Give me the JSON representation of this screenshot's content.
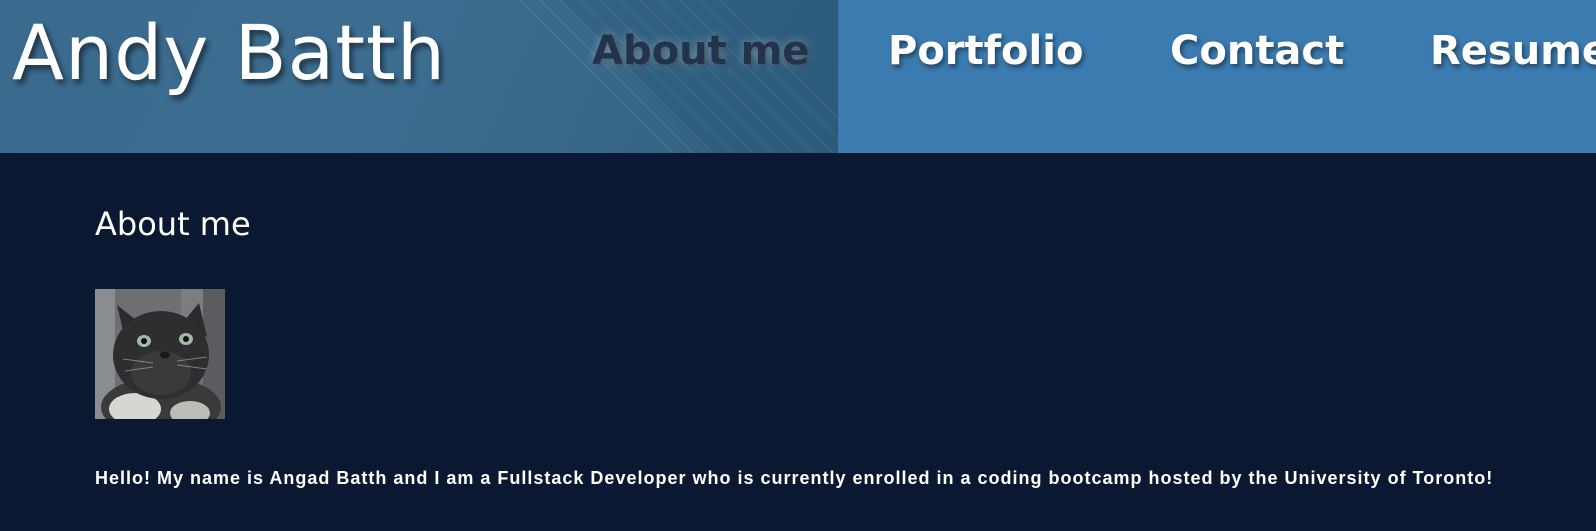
{
  "header": {
    "site_title": "Andy Batth",
    "nav": {
      "about": "About me",
      "portfolio": "Portfolio",
      "contact": "Contact",
      "resume": "Resume"
    }
  },
  "main": {
    "section_title": "About me",
    "photo_alt": "Photo of a cat",
    "bio": "Hello! My name is Angad Batth and I am a Fullstack Developer who is currently enrolled in a coding bootcamp hosted by the University of Toronto!"
  },
  "colors": {
    "page_background": "#0a1931",
    "header_left": "#3a6a8d",
    "header_right": "#3b7bb0",
    "active_nav_text": "#22334a",
    "text": "#ffffff"
  }
}
